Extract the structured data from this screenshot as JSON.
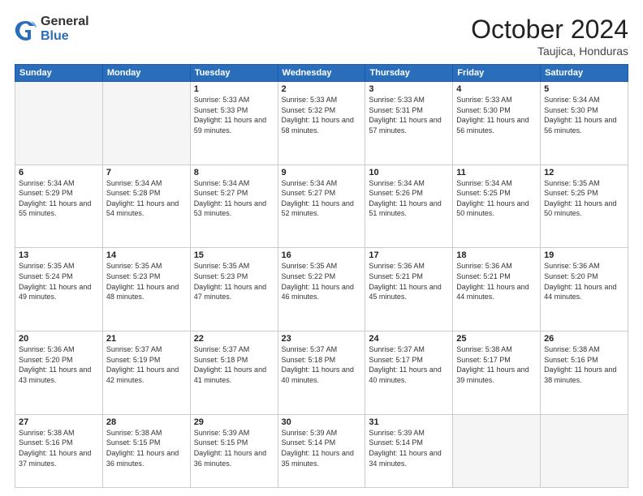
{
  "header": {
    "logo_general": "General",
    "logo_blue": "Blue",
    "month_title": "October 2024",
    "location": "Taujica, Honduras"
  },
  "days_of_week": [
    "Sunday",
    "Monday",
    "Tuesday",
    "Wednesday",
    "Thursday",
    "Friday",
    "Saturday"
  ],
  "weeks": [
    [
      {
        "day": "",
        "empty": true
      },
      {
        "day": "",
        "empty": true
      },
      {
        "day": "1",
        "sunrise": "5:33 AM",
        "sunset": "5:33 PM",
        "daylight": "11 hours and 59 minutes."
      },
      {
        "day": "2",
        "sunrise": "5:33 AM",
        "sunset": "5:32 PM",
        "daylight": "11 hours and 58 minutes."
      },
      {
        "day": "3",
        "sunrise": "5:33 AM",
        "sunset": "5:31 PM",
        "daylight": "11 hours and 57 minutes."
      },
      {
        "day": "4",
        "sunrise": "5:33 AM",
        "sunset": "5:30 PM",
        "daylight": "11 hours and 56 minutes."
      },
      {
        "day": "5",
        "sunrise": "5:34 AM",
        "sunset": "5:30 PM",
        "daylight": "11 hours and 56 minutes."
      }
    ],
    [
      {
        "day": "6",
        "sunrise": "5:34 AM",
        "sunset": "5:29 PM",
        "daylight": "11 hours and 55 minutes."
      },
      {
        "day": "7",
        "sunrise": "5:34 AM",
        "sunset": "5:28 PM",
        "daylight": "11 hours and 54 minutes."
      },
      {
        "day": "8",
        "sunrise": "5:34 AM",
        "sunset": "5:27 PM",
        "daylight": "11 hours and 53 minutes."
      },
      {
        "day": "9",
        "sunrise": "5:34 AM",
        "sunset": "5:27 PM",
        "daylight": "11 hours and 52 minutes."
      },
      {
        "day": "10",
        "sunrise": "5:34 AM",
        "sunset": "5:26 PM",
        "daylight": "11 hours and 51 minutes."
      },
      {
        "day": "11",
        "sunrise": "5:34 AM",
        "sunset": "5:25 PM",
        "daylight": "11 hours and 50 minutes."
      },
      {
        "day": "12",
        "sunrise": "5:35 AM",
        "sunset": "5:25 PM",
        "daylight": "11 hours and 50 minutes."
      }
    ],
    [
      {
        "day": "13",
        "sunrise": "5:35 AM",
        "sunset": "5:24 PM",
        "daylight": "11 hours and 49 minutes."
      },
      {
        "day": "14",
        "sunrise": "5:35 AM",
        "sunset": "5:23 PM",
        "daylight": "11 hours and 48 minutes."
      },
      {
        "day": "15",
        "sunrise": "5:35 AM",
        "sunset": "5:23 PM",
        "daylight": "11 hours and 47 minutes."
      },
      {
        "day": "16",
        "sunrise": "5:35 AM",
        "sunset": "5:22 PM",
        "daylight": "11 hours and 46 minutes."
      },
      {
        "day": "17",
        "sunrise": "5:36 AM",
        "sunset": "5:21 PM",
        "daylight": "11 hours and 45 minutes."
      },
      {
        "day": "18",
        "sunrise": "5:36 AM",
        "sunset": "5:21 PM",
        "daylight": "11 hours and 44 minutes."
      },
      {
        "day": "19",
        "sunrise": "5:36 AM",
        "sunset": "5:20 PM",
        "daylight": "11 hours and 44 minutes."
      }
    ],
    [
      {
        "day": "20",
        "sunrise": "5:36 AM",
        "sunset": "5:20 PM",
        "daylight": "11 hours and 43 minutes."
      },
      {
        "day": "21",
        "sunrise": "5:37 AM",
        "sunset": "5:19 PM",
        "daylight": "11 hours and 42 minutes."
      },
      {
        "day": "22",
        "sunrise": "5:37 AM",
        "sunset": "5:18 PM",
        "daylight": "11 hours and 41 minutes."
      },
      {
        "day": "23",
        "sunrise": "5:37 AM",
        "sunset": "5:18 PM",
        "daylight": "11 hours and 40 minutes."
      },
      {
        "day": "24",
        "sunrise": "5:37 AM",
        "sunset": "5:17 PM",
        "daylight": "11 hours and 40 minutes."
      },
      {
        "day": "25",
        "sunrise": "5:38 AM",
        "sunset": "5:17 PM",
        "daylight": "11 hours and 39 minutes."
      },
      {
        "day": "26",
        "sunrise": "5:38 AM",
        "sunset": "5:16 PM",
        "daylight": "11 hours and 38 minutes."
      }
    ],
    [
      {
        "day": "27",
        "sunrise": "5:38 AM",
        "sunset": "5:16 PM",
        "daylight": "11 hours and 37 minutes."
      },
      {
        "day": "28",
        "sunrise": "5:38 AM",
        "sunset": "5:15 PM",
        "daylight": "11 hours and 36 minutes."
      },
      {
        "day": "29",
        "sunrise": "5:39 AM",
        "sunset": "5:15 PM",
        "daylight": "11 hours and 36 minutes."
      },
      {
        "day": "30",
        "sunrise": "5:39 AM",
        "sunset": "5:14 PM",
        "daylight": "11 hours and 35 minutes."
      },
      {
        "day": "31",
        "sunrise": "5:39 AM",
        "sunset": "5:14 PM",
        "daylight": "11 hours and 34 minutes."
      },
      {
        "day": "",
        "empty": true
      },
      {
        "day": "",
        "empty": true
      }
    ]
  ],
  "labels": {
    "sunrise": "Sunrise:",
    "sunset": "Sunset:",
    "daylight": "Daylight:"
  }
}
